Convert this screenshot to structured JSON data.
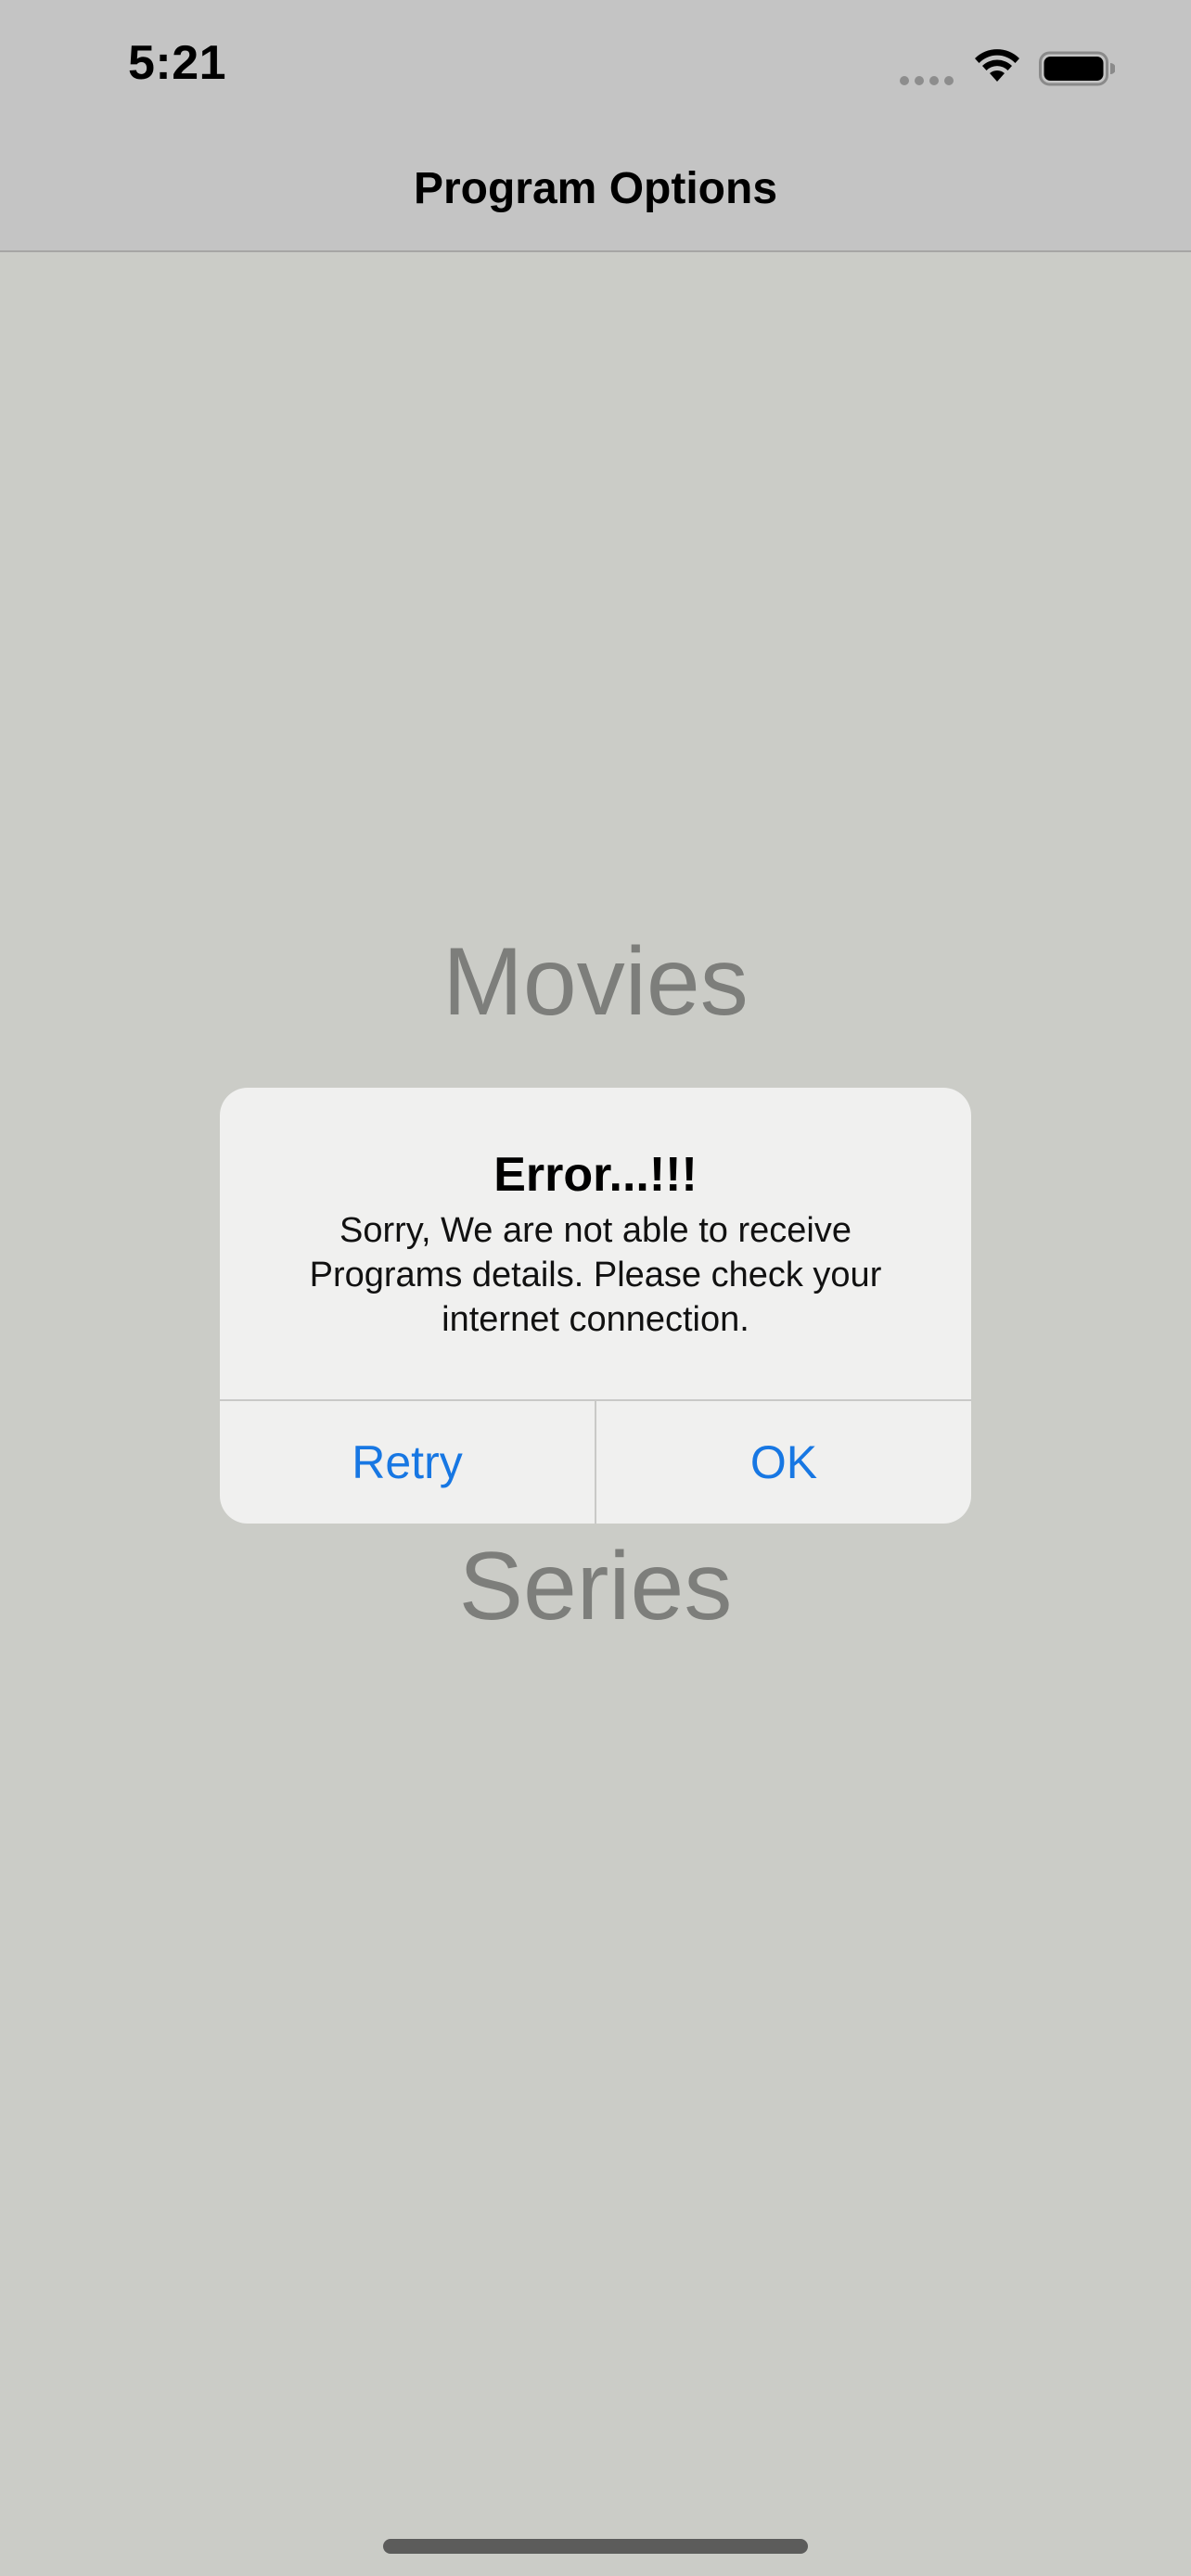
{
  "status_bar": {
    "time": "5:21"
  },
  "nav": {
    "title": "Program Options"
  },
  "options": {
    "movies": "Movies",
    "series": "Series"
  },
  "alert": {
    "title": "Error...!!!",
    "message": "Sorry, We are not able to receive Programs details. Please check your internet connection.",
    "buttons": {
      "retry": "Retry",
      "ok": "OK"
    }
  },
  "icons": {
    "wifi": "wifi-icon",
    "battery": "battery-icon",
    "signal": "cellular-signal-icon"
  },
  "colors": {
    "accent": "#1777e3",
    "background": "#cbccc7",
    "option_text": "#7d7e7b"
  }
}
